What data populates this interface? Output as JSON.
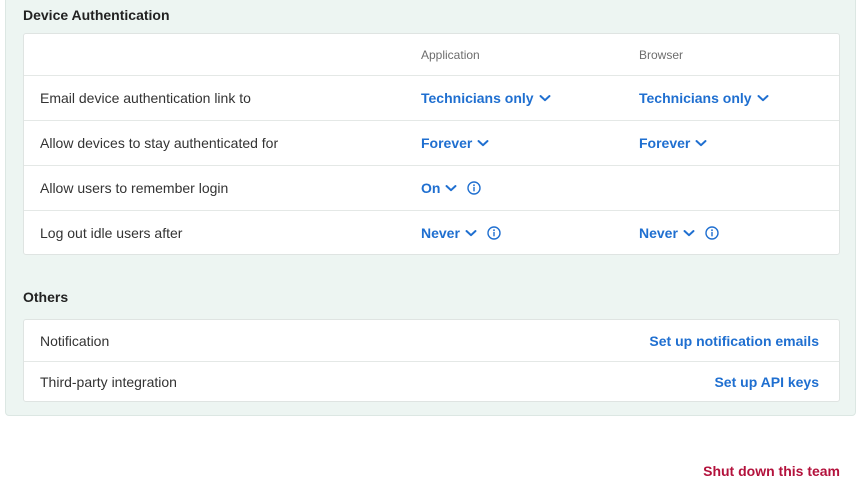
{
  "device_auth": {
    "title": "Device Authentication",
    "columns": {
      "application": "Application",
      "browser": "Browser"
    },
    "rows": [
      {
        "label": "Email device authentication link to",
        "application": "Technicians only",
        "browser": "Technicians only"
      },
      {
        "label": "Allow devices to stay authenticated for",
        "application": "Forever",
        "browser": "Forever"
      },
      {
        "label": "Allow users to remember login",
        "application": "On",
        "browser": ""
      },
      {
        "label": "Log out idle users after",
        "application": "Never",
        "browser": "Never"
      }
    ]
  },
  "others": {
    "title": "Others",
    "rows": [
      {
        "label": "Notification",
        "action": "Set up notification emails"
      },
      {
        "label": "Third-party integration",
        "action": "Set up API keys"
      }
    ]
  },
  "footer": {
    "danger_label": "Shut down this team"
  },
  "icons": {
    "dropdown": "chevron-down-icon",
    "info": "info-icon"
  },
  "colors": {
    "accent": "#1f6fd0",
    "danger": "#b3123c",
    "panel_bg": "#edf5f2"
  }
}
